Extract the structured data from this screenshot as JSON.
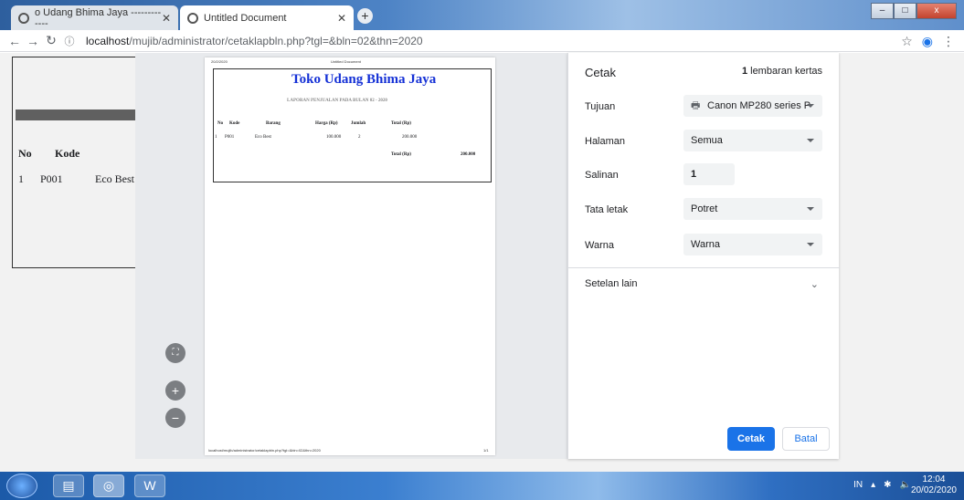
{
  "browser": {
    "tabs": [
      {
        "title": "o Udang Bhima Jaya -------------"
      },
      {
        "title": "Untitled Document"
      }
    ],
    "new_tab": "+",
    "url_host": "localhost",
    "url_path": "/mujib/administrator/cetaklapbln.php?tgl=&bln=02&thn=2020",
    "window_buttons": {
      "minimize": "–",
      "maximize": "□",
      "close": "x"
    }
  },
  "background_page": {
    "headers": [
      "No",
      "Kode"
    ],
    "row": {
      "no": "1",
      "kode": "P001",
      "barang": "Eco Best"
    }
  },
  "preview": {
    "header_left": "20/2/2020",
    "header_center": "Untitled Document",
    "title": "Toko Udang Bhima Jaya",
    "subtitle": "LAPORAN PENJUALAN PADA BULAN 02 - 2020",
    "columns": [
      "No",
      "Kode",
      "Barang",
      "Harga (Rp)",
      "Jumlah",
      "Total (Rp)"
    ],
    "rows": [
      {
        "no": "1",
        "kode": "P001",
        "barang": "Eco Best",
        "harga": "100.000",
        "jumlah": "2",
        "total": "200.000"
      }
    ],
    "total_label": "Total (Rp)",
    "total_value": "200.000",
    "footer_left": "localhost/mujib/administrator/cetaklapbln.php?tgl=&bln=02&thn=2020",
    "footer_right": "1/1",
    "zoom_fit": "⛶",
    "zoom_in": "+",
    "zoom_out": "−"
  },
  "print_panel": {
    "title": "Cetak",
    "sheets_count": "1",
    "sheets_label": "lembaran kertas",
    "destination_label": "Tujuan",
    "destination_value": "Canon MP280 series P",
    "pages_label": "Halaman",
    "pages_value": "Semua",
    "copies_label": "Salinan",
    "copies_value": "1",
    "layout_label": "Tata letak",
    "layout_value": "Potret",
    "color_label": "Warna",
    "color_value": "Warna",
    "more_settings": "Setelan lain",
    "print_button": "Cetak",
    "cancel_button": "Batal"
  },
  "taskbar": {
    "lang": "IN",
    "time": "12:04",
    "date": "20/02/2020"
  }
}
